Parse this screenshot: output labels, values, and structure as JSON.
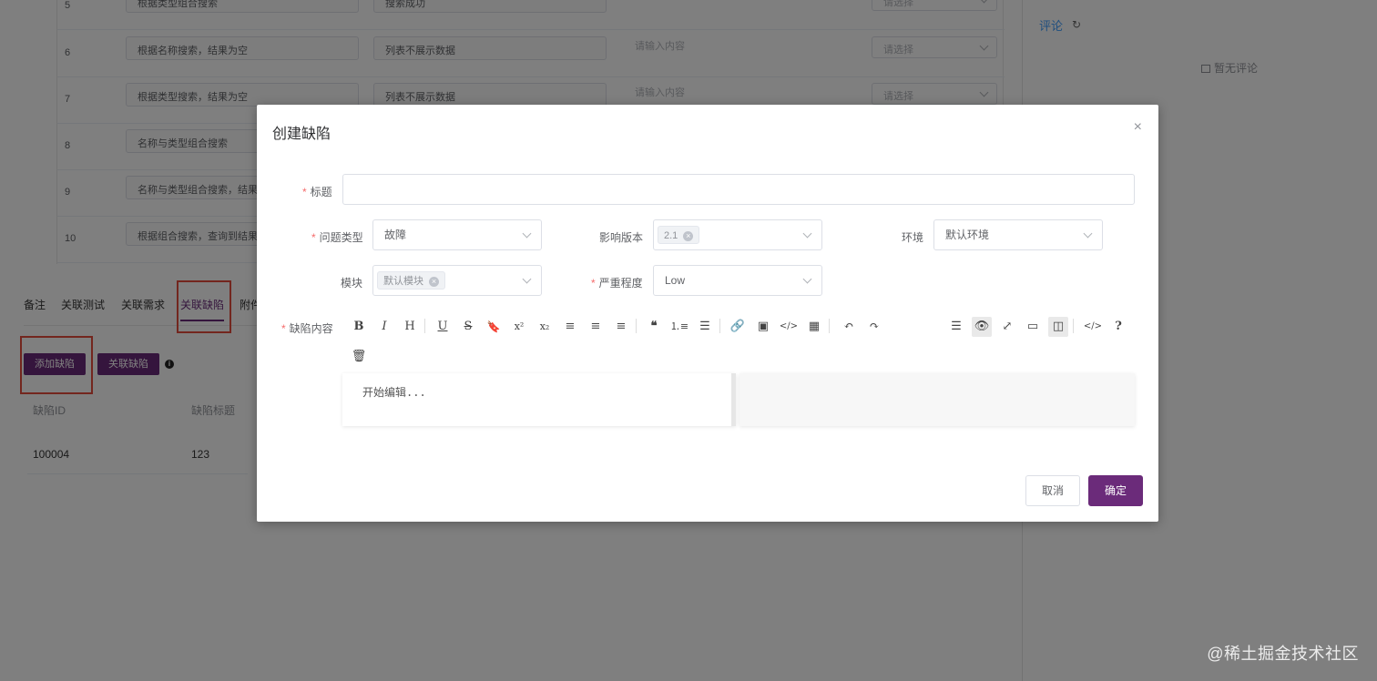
{
  "background": {
    "steps": [
      {
        "num": "5",
        "step": "根据类型组合搜索",
        "expect": "搜索成功",
        "note": "",
        "select": "请选择"
      },
      {
        "num": "6",
        "step": "根据名称搜索，结果为空",
        "expect": "列表不展示数据",
        "note": "请输入内容",
        "select": "请选择"
      },
      {
        "num": "7",
        "step": "根据类型搜索，结果为空",
        "expect": "列表不展示数据",
        "note": "请输入内容",
        "select": "请选择"
      },
      {
        "num": "8",
        "step": "名称与类型组合搜索",
        "expect": "",
        "note": "",
        "select": ""
      },
      {
        "num": "9",
        "step": "名称与类型组合搜索，结果为",
        "expect": "",
        "note": "",
        "select": ""
      },
      {
        "num": "10",
        "step": "根据组合搜索，查询到结果后",
        "expect": "",
        "note": "",
        "select": ""
      }
    ],
    "tabs": [
      "备注",
      "关联测试",
      "关联需求",
      "关联缺陷",
      "附件"
    ],
    "add_bug_button": "添加缺陷",
    "link_bug_button": "关联缺陷",
    "bug_table": {
      "headers": [
        "缺陷ID",
        "缺陷标题"
      ],
      "rows": [
        [
          "100004",
          "123"
        ]
      ]
    },
    "comment_tab": "评论",
    "no_comment": "暂无评论",
    "watermark": "@稀土掘金技术社区"
  },
  "modal": {
    "title": "创建缺陷",
    "close": "×",
    "fields": {
      "title_label": "标题",
      "title_value": "",
      "type_label": "问题类型",
      "type_value": "故障",
      "version_label": "影响版本",
      "version_tag": "2.1",
      "env_label": "环境",
      "env_value": "默认环境",
      "module_label": "模块",
      "module_tag": "默认模块",
      "severity_label": "严重程度",
      "severity_value": "Low",
      "content_label": "缺陷内容"
    },
    "editor": {
      "placeholder": "开始编辑...",
      "toolbar": [
        "bold",
        "italic",
        "header",
        "underline",
        "strikethrough",
        "mark",
        "superscript",
        "subscript",
        "align-left",
        "align-center",
        "align-right",
        "quote",
        "ordered-list",
        "unordered-list",
        "link",
        "image",
        "code",
        "table",
        "undo",
        "redo",
        "navigation",
        "preview",
        "fullscreen",
        "read-mode",
        "subfield",
        "html",
        "help",
        "trash"
      ]
    },
    "cancel_label": "取消",
    "ok_label": "确定"
  },
  "colors": {
    "primary": "#6b2b7a",
    "highlight_box": "#e74c3c",
    "required": "#f56c6c",
    "link": "#409eff"
  }
}
